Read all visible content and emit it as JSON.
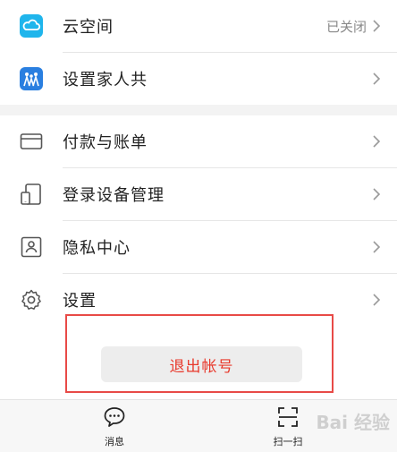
{
  "settings_list": {
    "cloud": {
      "label": "云空间",
      "status": "已关闭",
      "icon": "cloud-icon"
    },
    "family": {
      "label": "设置家人共",
      "icon": "family-share-icon"
    },
    "payment": {
      "label": "付款与账单",
      "icon": "card-icon"
    },
    "devices": {
      "label": "登录设备管理",
      "icon": "devices-icon"
    },
    "privacy": {
      "label": "隐私中心",
      "icon": "id-card-icon"
    },
    "settings": {
      "label": "设置",
      "icon": "gear-icon"
    }
  },
  "logout": {
    "label": "退出帐号"
  },
  "tabbar": {
    "messages": {
      "label": "消息",
      "icon": "chat-bubble-icon"
    },
    "scan": {
      "label": "扫一扫",
      "icon": "scan-icon"
    }
  },
  "watermark": {
    "text": "Bai 经验"
  },
  "colors": {
    "accent_red": "#e8392c",
    "cloud_blue": "#1fb5ec",
    "family_blue": "#2a7fe0",
    "highlight_red": "#e84a47"
  }
}
